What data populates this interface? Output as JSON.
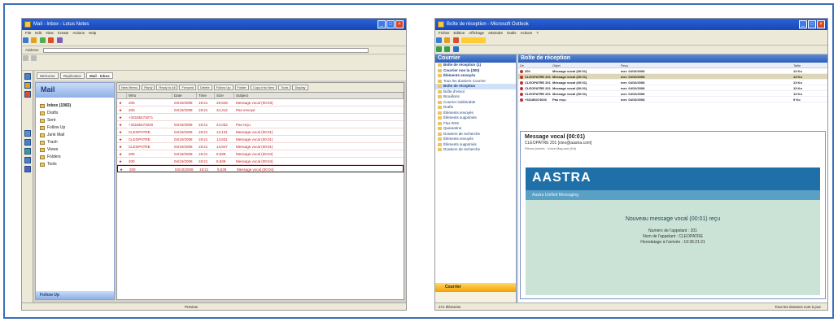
{
  "left": {
    "title": "Mail - Inbox - Lotus Notes",
    "menu": [
      "File",
      "Edit",
      "View",
      "Create",
      "Actions",
      "Help"
    ],
    "address_label": "Address",
    "tabs": [
      "Welcome",
      "Replication",
      "Mail - Inbox"
    ],
    "nav_title": "Mail",
    "nav_items": [
      "Inbox (1983)",
      "Drafts",
      "Sent",
      "Follow Up",
      "Junk Mail",
      "Trash",
      "Views",
      "Folders",
      "Tools"
    ],
    "nav_footer": "Follow Up",
    "actions": [
      "New Memo",
      "Reply",
      "Reply to All",
      "Forward",
      "Delete",
      "Follow Up",
      "Folder",
      "Copy Into New",
      "Tools",
      "Display"
    ],
    "columns": [
      "",
      "Who",
      "Date",
      "Time",
      "Size",
      "Subject"
    ],
    "rows": [
      {
        "who": "200",
        "date": "04/10/2008",
        "time": "19:21",
        "size": "29,848",
        "subject": "Message vocal (00:03)"
      },
      {
        "who": "200",
        "date": "04/10/2008",
        "time": "19:21",
        "size": "34,312",
        "subject": "Pas envoyé"
      },
      {
        "who": "+33185474071",
        "date": "",
        "time": "",
        "size": "",
        "subject": ""
      },
      {
        "who": "+33185474040",
        "date": "04/10/2008",
        "time": "19:21",
        "size": "24,032",
        "subject": "Pas reçu"
      },
      {
        "who": "CLEOPATRE",
        "date": "04/10/2008",
        "time": "19:21",
        "size": "13,131",
        "subject": "Message vocal (00:01)"
      },
      {
        "who": "CLEOPATRE",
        "date": "04/10/2008",
        "time": "19:21",
        "size": "13,831",
        "subject": "Message vocal (00:01)"
      },
      {
        "who": "CLEOPATRE",
        "date": "04/10/2008",
        "time": "19:21",
        "size": "13,847",
        "subject": "Message vocal (00:01)"
      },
      {
        "who": "200",
        "date": "04/10/2008",
        "time": "19:21",
        "size": "8,839",
        "subject": "Message vocal (00:04)"
      },
      {
        "who": "200",
        "date": "04/10/2008",
        "time": "19:21",
        "size": "8,839",
        "subject": "Message vocal (00:04)"
      },
      {
        "who": "200",
        "date": "04/10/2008",
        "time": "19:21",
        "size": "8,839",
        "subject": "Message vocal (00:04)"
      }
    ],
    "status": "Preview"
  },
  "right": {
    "title": "Boîte de réception - Microsoft Outlook",
    "menu": [
      "Fichier",
      "Edition",
      "Affichage",
      "Atteindre",
      "Outils",
      "Actions",
      "?"
    ],
    "nav_title": "Courrier",
    "tree": [
      "Boîte de réception (1)",
      "Courrier non lu (300)",
      "Éléments envoyés",
      "Tous les dossiers Courrier",
      "Boîte de réception",
      "Boîte d'envoi",
      "Brouillons",
      "Courrier indésirable",
      "Drafts",
      "Éléments envoyés",
      "Éléments supprimés",
      "Flux RSS",
      "Quarantine",
      "Dossiers de recherche",
      "Éléments envoyés",
      "Éléments supprimés",
      "Dossiers de recherche"
    ],
    "nav_footer": "Courrier",
    "main_title": "Boîte de réception",
    "columns": [
      "De",
      "Objet",
      "Reçu",
      "Taille"
    ],
    "rows": [
      {
        "from": "200",
        "subject": "Message vocal (00:01)",
        "received": "mer. 04/10/2008",
        "size": "13 Ko"
      },
      {
        "from": "CLEOPATRE 201",
        "subject": "Message vocal (00:01)",
        "received": "mer. 04/10/2008",
        "size": "13 Ko"
      },
      {
        "from": "CLEOPATRE 201",
        "subject": "Message vocal (00:01)",
        "received": "mer. 04/10/2008",
        "size": "13 Ko"
      },
      {
        "from": "CLEOPATRE 201",
        "subject": "Message vocal (00:01)",
        "received": "mer. 04/10/2008",
        "size": "13 Ko"
      },
      {
        "from": "CLEOPATRE 201",
        "subject": "Message vocal (00:01)",
        "received": "mer. 04/10/2008",
        "size": "13 Ko"
      },
      {
        "from": "+33185474040",
        "subject": "Pas reçu",
        "received": "mer. 04/10/2008",
        "size": "9 Ko"
      }
    ],
    "preview": {
      "subject": "Message vocal (00:01)",
      "from": "CLEOPATRE 201 [cleo@aastra.com]",
      "meta": "Pièces jointes : Voice Msg.wav (Kb)",
      "brand": "AASTRA",
      "brand_sub": "Aastra Unified Messaging",
      "msg_title": "Nouveau message vocal (00:01) reçu",
      "lines": [
        "Numéro de l'appelant : 201",
        "Nom de l'appelant : CLEOPATRE",
        "Horodatage à l'arrivée : 19:36:21:21"
      ]
    },
    "status": "271 éléments",
    "status_right": "Tous les dossiers sont à jour"
  }
}
